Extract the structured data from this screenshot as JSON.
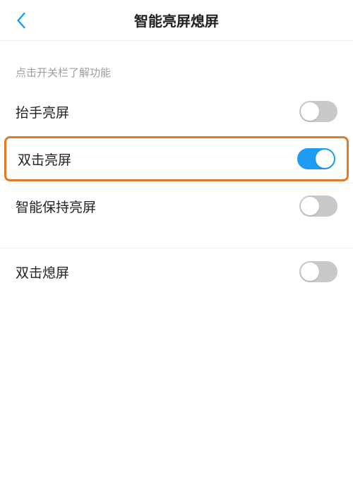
{
  "header": {
    "title": "智能亮屏熄屏"
  },
  "hint": "点击开关栏了解功能",
  "items": [
    {
      "label": "抬手亮屏",
      "on": false
    },
    {
      "label": "双击亮屏",
      "on": true,
      "highlighted": true
    },
    {
      "label": "智能保持亮屏",
      "on": false
    }
  ],
  "group2": [
    {
      "label": "双击熄屏",
      "on": false
    }
  ],
  "colors": {
    "accent": "#1e9cf4",
    "highlightBorder": "#e37a2a"
  }
}
